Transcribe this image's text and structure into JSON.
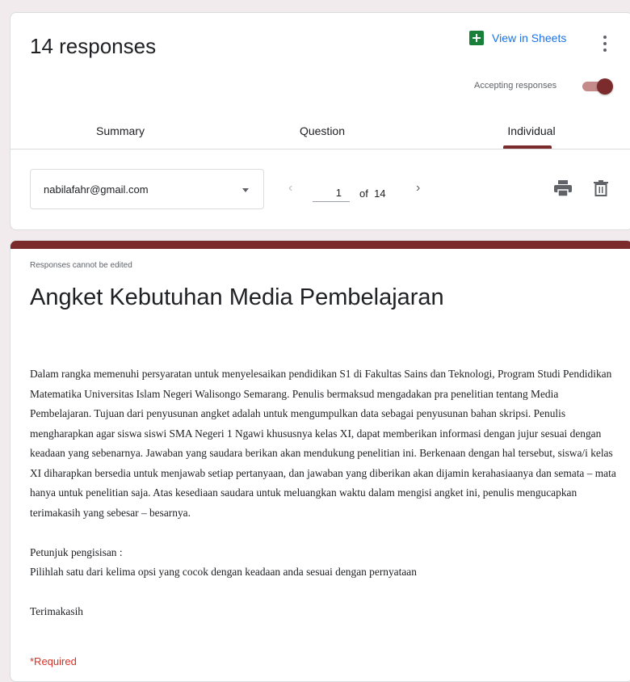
{
  "header": {
    "responses_title": "14 responses",
    "view_in_sheets": "View in Sheets",
    "accepting_label": "Accepting responses",
    "accepting_on": true
  },
  "tabs": [
    {
      "label": "Summary"
    },
    {
      "label": "Question"
    },
    {
      "label": "Individual",
      "selected": true
    }
  ],
  "respondent": {
    "email": "nabilafahr@gmail.com",
    "page": "1",
    "of_label": "of",
    "total": "14"
  },
  "form": {
    "notice": "Responses cannot be edited",
    "title": "Angket Kebutuhan Media Pembelajaran",
    "description": "Dalam rangka memenuhi persyaratan untuk menyelesaikan pendidikan S1 di Fakultas Sains dan Teknologi, Program Studi Pendidikan Matematika Universitas Islam Negeri Walisongo Semarang. Penulis bermaksud mengadakan pra penelitian tentang Media Pembelajaran. Tujuan dari penyusunan angket adalah untuk mengumpulkan data sebagai penyusunan bahan skripsi. Penulis mengharapkan agar siswa siswi SMA Negeri 1 Ngawi khususnya kelas XI, dapat memberikan informasi dengan jujur sesuai dengan keadaan yang sebenarnya. Jawaban yang saudara berikan akan mendukung penelitian ini. Berkenaan dengan hal tersebut, siswa/i kelas XI diharapkan bersedia untuk menjawab setiap pertanyaan, dan jawaban yang diberikan akan dijamin kerahasiaanya dan semata – mata hanya untuk penelitian saja. Atas kesediaan saudara untuk meluangkan waktu dalam mengisi angket ini, penulis mengucapkan terimakasih yang sebesar – besarnya.",
    "instructions_heading": "Petunjuk pengisisan :",
    "instructions_text": "Pilihlah satu dari kelima opsi yang cocok dengan keadaan anda sesuai dengan pernyataan",
    "thanks": "Terimakasih",
    "required_label": "*Required"
  },
  "colors": {
    "accent": "#7b2b2b",
    "link": "#1a73e8",
    "sheets": "#188038",
    "required": "#d93025"
  },
  "icons": [
    "sheets-icon",
    "more-vert-icon",
    "chevron-left-icon",
    "chevron-right-icon",
    "print-icon",
    "trash-icon",
    "dropdown-caret-icon"
  ]
}
